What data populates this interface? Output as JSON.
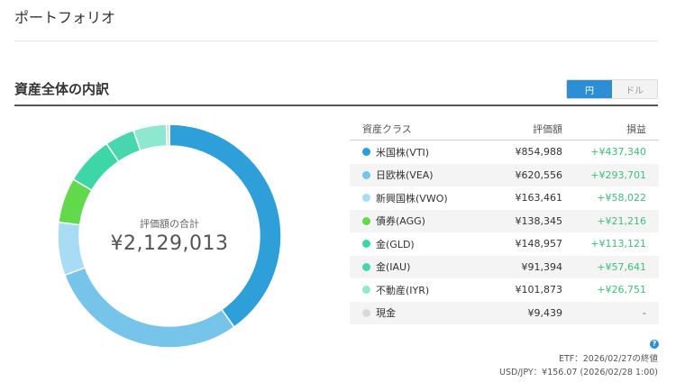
{
  "header": {
    "title": "ポートフォリオ"
  },
  "section": {
    "title": "資産全体の内訳"
  },
  "currency_toggle": {
    "yen_label": "円",
    "dollar_label": "ドル",
    "selected": "円"
  },
  "summary": {
    "label": "評価額の合計",
    "total": "¥2,129,013"
  },
  "table": {
    "headers": {
      "name": "資産クラス",
      "value": "評価額",
      "gain": "損益"
    },
    "rows": [
      {
        "name": "米国株(VTI)",
        "value": "¥854,988",
        "gain": "+¥437,340",
        "amount": 854988,
        "color": "#2f9fd9"
      },
      {
        "name": "日欧株(VEA)",
        "value": "¥620,556",
        "gain": "+¥293,701",
        "amount": 620556,
        "color": "#76c4ea"
      },
      {
        "name": "新興国株(VWO)",
        "value": "¥163,461",
        "gain": "+¥58,022",
        "amount": 163461,
        "color": "#a8dcf5"
      },
      {
        "name": "債券(AGG)",
        "value": "¥138,345",
        "gain": "+¥21,216",
        "amount": 138345,
        "color": "#62d94a"
      },
      {
        "name": "金(GLD)",
        "value": "¥148,957",
        "gain": "+¥113,121",
        "amount": 148957,
        "color": "#3dd6a6"
      },
      {
        "name": "金(IAU)",
        "value": "¥91,394",
        "gain": "+¥57,641",
        "amount": 91394,
        "color": "#47d6ae"
      },
      {
        "name": "不動産(IYR)",
        "value": "¥101,873",
        "gain": "+¥26,751",
        "amount": 101873,
        "color": "#8ee8cf"
      },
      {
        "name": "現金",
        "value": "¥9,439",
        "gain": "-",
        "amount": 9439,
        "color": "#d9d9d9"
      }
    ]
  },
  "notes": {
    "etf": "ETF：2026/02/27の終値",
    "fx": "USD/JPY：¥156.07 (2026/02/28 1:00)",
    "help_icon": "help-icon"
  }
}
